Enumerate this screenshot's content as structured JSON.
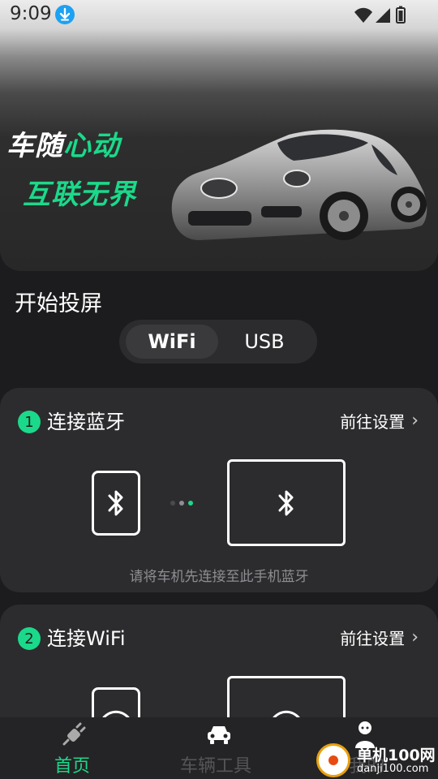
{
  "status_bar": {
    "time": "9:09"
  },
  "hero": {
    "slogan_line1_white": "车随",
    "slogan_line1_green": "心动",
    "slogan_line2": "互联无界"
  },
  "cast": {
    "title": "开始投屏",
    "modes": [
      {
        "label": "WiFi",
        "selected": true
      },
      {
        "label": "USB",
        "selected": false
      }
    ]
  },
  "steps": [
    {
      "number": "1",
      "title": "连接蓝牙",
      "link": "前往设置",
      "hint": "请将车机先连接至此手机蓝牙"
    },
    {
      "number": "2",
      "title": "连接WiFi",
      "link": "前往设置"
    }
  ],
  "bottom_nav": [
    {
      "label": "首页",
      "icon": "plug-icon",
      "active": true
    },
    {
      "label": "车辆工具",
      "icon": "car-icon",
      "active": false
    },
    {
      "label": "我的",
      "icon": "person-icon",
      "active": false
    }
  ],
  "watermark": {
    "title": "单机100网",
    "subtitle": "danji100.com"
  },
  "colors": {
    "accent": "#1bd98a",
    "background": "#1c1c1e",
    "card": "#2c2c2e"
  }
}
